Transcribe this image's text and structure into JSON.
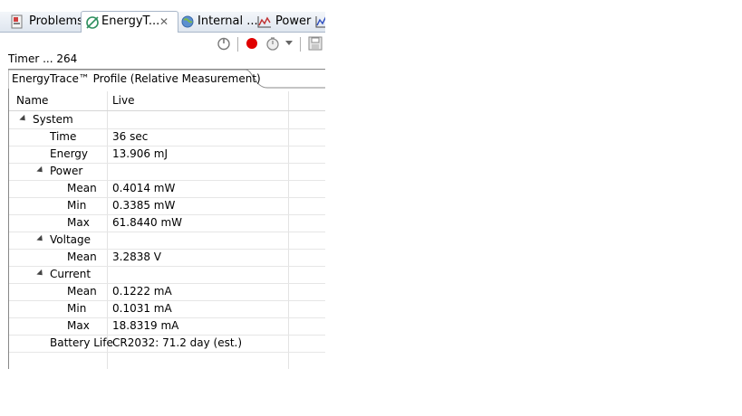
{
  "tabs": [
    {
      "label": "Problems",
      "icon": "problems-icon"
    },
    {
      "label": "EnergyT...",
      "icon": "energytrace-icon",
      "active": true,
      "close_glyph": "✕"
    },
    {
      "label": "Internal ...",
      "icon": "globe-icon"
    },
    {
      "label": "Power",
      "icon": "chart-icon"
    },
    {
      "label": "",
      "icon": "chart-icon"
    }
  ],
  "toolbar": {
    "icons": [
      "power-icon",
      "record-icon",
      "stopwatch-icon",
      "dropdown-icon",
      "save-icon"
    ],
    "record_color": "#e00000"
  },
  "timer_text": "Timer ... 264",
  "profile_tab_label": "EnergyTrace™ Profile (Relative Measurement)",
  "table": {
    "headers": [
      "Name",
      "Live"
    ],
    "rows": [
      {
        "name": "System",
        "value": "",
        "expander": true
      },
      {
        "name": "Time",
        "value": "36 sec"
      },
      {
        "name": "Energy",
        "value": "13.906 mJ"
      },
      {
        "name": "Power",
        "value": "",
        "expander": true
      },
      {
        "name": "Mean",
        "value": "0.4014 mW"
      },
      {
        "name": "Min",
        "value": "0.3385 mW"
      },
      {
        "name": "Max",
        "value": "61.8440 mW"
      },
      {
        "name": "Voltage",
        "value": "",
        "expander": true
      },
      {
        "name": "Mean",
        "value": "3.2838 V"
      },
      {
        "name": "Current",
        "value": "",
        "expander": true
      },
      {
        "name": "Mean",
        "value": "0.1222 mA"
      },
      {
        "name": "Min",
        "value": "0.1031 mA"
      },
      {
        "name": "Max",
        "value": "18.8319 mA"
      },
      {
        "name": "Battery Life",
        "value": "CR2032: 71.2 day (est.)"
      }
    ]
  }
}
